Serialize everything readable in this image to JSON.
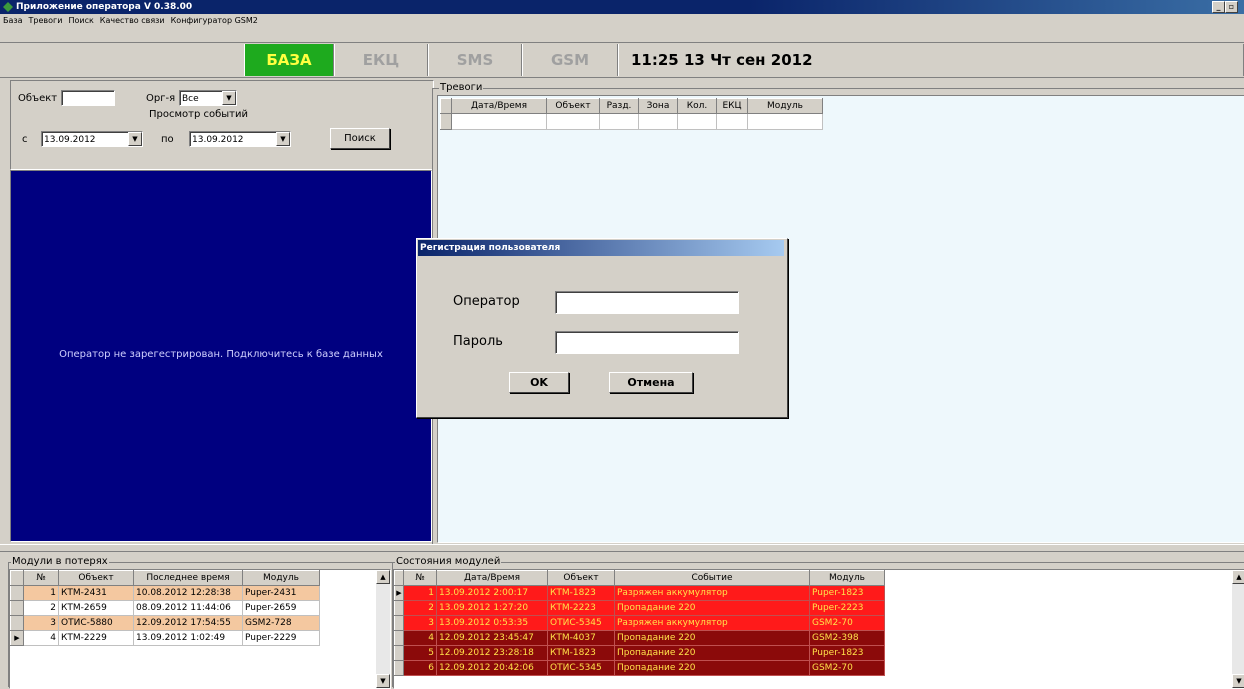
{
  "window": {
    "title": "Приложение оператора V 0.38.00"
  },
  "menu": [
    "База",
    "Тревоги",
    "Поиск",
    "Качество связи",
    "Конфигуратор GSM2"
  ],
  "status_tabs": {
    "baza": "БАЗА",
    "ekc": "ЕКЦ",
    "sms": "SMS",
    "gsm": "GSM"
  },
  "clock": "11:25 13 Чт сен 2012",
  "filter": {
    "object_label": "Объект",
    "object_value": "",
    "org_label": "Орг-я",
    "org_value": "Все",
    "view_events_label": "Просмотр событий",
    "from_label": "с",
    "from_value": "13.09.2012",
    "to_label": "по",
    "to_value": "13.09.2012",
    "search_label": "Поиск"
  },
  "blue_message": "Оператор не зарегестрирован. Подключитесь к базе данных",
  "alarms": {
    "group_label": "Тревоги",
    "columns": [
      "Дата/Время",
      "Объект",
      "Разд.",
      "Зона",
      "Кол.",
      "ЕКЦ",
      "Модуль"
    ]
  },
  "dialog": {
    "title": "Регистрация пользователя",
    "operator_label": "Оператор",
    "operator_value": "",
    "password_label": "Пароль",
    "password_value": "",
    "ok_label": "OK",
    "cancel_label": "Отмена"
  },
  "lost_modules": {
    "group_label": "Модули в потерях",
    "columns": [
      "№",
      "Объект",
      "Последнее время",
      "Модуль"
    ],
    "rows": [
      {
        "n": "1",
        "object": "КТМ-2431",
        "time": "10.08.2012 12:28:38",
        "module": "Puper-2431",
        "color": "#f4c8a0"
      },
      {
        "n": "2",
        "object": "КТМ-2659",
        "time": "08.09.2012 11:44:06",
        "module": "Puper-2659",
        "color": "#ffffff"
      },
      {
        "n": "3",
        "object": "ОТИС-5880",
        "time": "12.09.2012 17:54:55",
        "module": "GSM2-728",
        "color": "#f4c8a0"
      },
      {
        "n": "4",
        "object": "КТМ-2229",
        "time": "13.09.2012 1:02:49",
        "module": "Puper-2229",
        "color": "#ffffff"
      }
    ]
  },
  "module_states": {
    "group_label": "Состояния модулей",
    "columns": [
      "№",
      "Дата/Время",
      "Объект",
      "Событие",
      "Модуль"
    ],
    "rows": [
      {
        "n": "1",
        "time": "13.09.2012 2:00:17",
        "object": "КТМ-1823",
        "event": "Разряжен аккумулятор",
        "module": "Puper-1823",
        "color": "#ff1a1a"
      },
      {
        "n": "2",
        "time": "13.09.2012 1:27:20",
        "object": "КТМ-2223",
        "event": "Пропадание 220",
        "module": "Puper-2223",
        "color": "#ff1a1a"
      },
      {
        "n": "3",
        "time": "13.09.2012 0:53:35",
        "object": "ОТИС-5345",
        "event": "Разряжен аккумулятор",
        "module": "GSM2-70",
        "color": "#ff1a1a"
      },
      {
        "n": "4",
        "time": "12.09.2012 23:45:47",
        "object": "КТМ-4037",
        "event": "Пропадание 220",
        "module": "GSM2-398",
        "color": "#8b0a0a"
      },
      {
        "n": "5",
        "time": "12.09.2012 23:28:18",
        "object": "КТМ-1823",
        "event": "Пропадание 220",
        "module": "Puper-1823",
        "color": "#8b0a0a"
      },
      {
        "n": "6",
        "time": "12.09.2012 20:42:06",
        "object": "ОТИС-5345",
        "event": "Пропадание 220",
        "module": "GSM2-70",
        "color": "#8b0a0a"
      }
    ]
  }
}
